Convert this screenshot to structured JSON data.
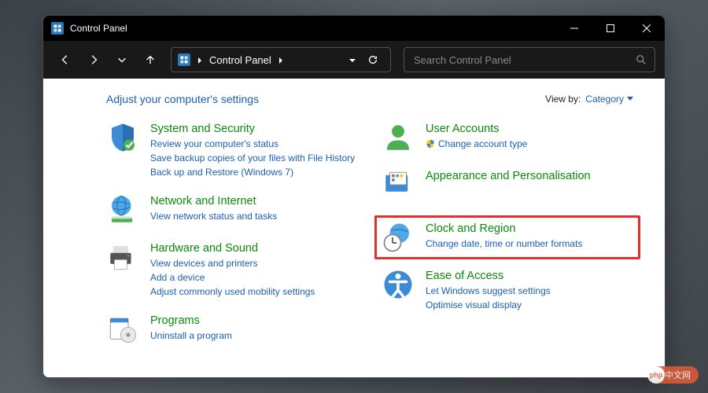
{
  "window": {
    "title": "Control Panel"
  },
  "nav": {
    "breadcrumb": "Control Panel",
    "search_placeholder": "Search Control Panel"
  },
  "header": {
    "heading": "Adjust your computer's settings",
    "view_by_label": "View by:",
    "view_by_value": "Category"
  },
  "categories": {
    "system_security": {
      "title": "System and Security",
      "links": [
        "Review your computer's status",
        "Save backup copies of your files with File History",
        "Back up and Restore (Windows 7)"
      ]
    },
    "network": {
      "title": "Network and Internet",
      "links": [
        "View network status and tasks"
      ]
    },
    "hardware": {
      "title": "Hardware and Sound",
      "links": [
        "View devices and printers",
        "Add a device",
        "Adjust commonly used mobility settings"
      ]
    },
    "programs": {
      "title": "Programs",
      "links": [
        "Uninstall a program"
      ]
    },
    "user_accounts": {
      "title": "User Accounts",
      "links": [
        "Change account type"
      ]
    },
    "appearance": {
      "title": "Appearance and Personalisation",
      "links": []
    },
    "clock_region": {
      "title": "Clock and Region",
      "links": [
        "Change date, time or number formats"
      ]
    },
    "ease_access": {
      "title": "Ease of Access",
      "links": [
        "Let Windows suggest settings",
        "Optimise visual display"
      ]
    }
  },
  "watermark": "中文网"
}
